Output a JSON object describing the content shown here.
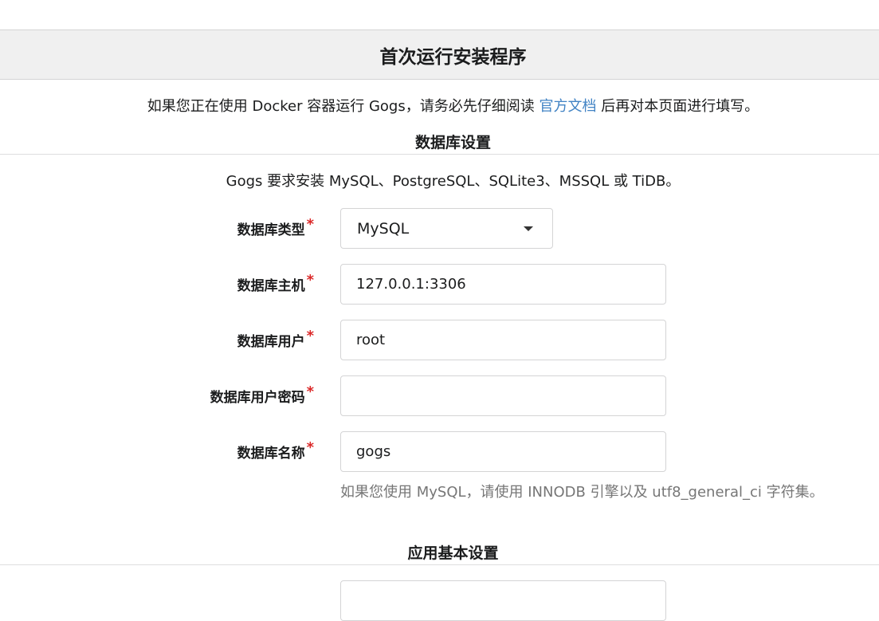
{
  "header": {
    "title": "首次运行安装程序"
  },
  "docker_note": {
    "before": "如果您正在使用 Docker 容器运行 Gogs，请务必先仔细阅读 ",
    "link": "官方文档",
    "after": " 后再对本页面进行填写。"
  },
  "database": {
    "section_title": "数据库设置",
    "note": "Gogs 要求安装 MySQL、PostgreSQL、SQLite3、MSSQL 或 TiDB。",
    "required_mark": "*",
    "type": {
      "label": "数据库类型",
      "value": "MySQL"
    },
    "host": {
      "label": "数据库主机",
      "value": "127.0.0.1:3306"
    },
    "user": {
      "label": "数据库用户",
      "value": "root"
    },
    "password": {
      "label": "数据库用户密码",
      "value": ""
    },
    "name": {
      "label": "数据库名称",
      "value": "gogs"
    },
    "help": "如果您使用 MySQL，请使用 INNODB 引擎以及 utf8_general_ci 字符集。"
  },
  "app": {
    "section_title": "应用基本设置"
  },
  "colors": {
    "link": "#4183c4",
    "required": "#db2828",
    "header_bg": "#f0f0f0",
    "help_text": "#767676"
  }
}
